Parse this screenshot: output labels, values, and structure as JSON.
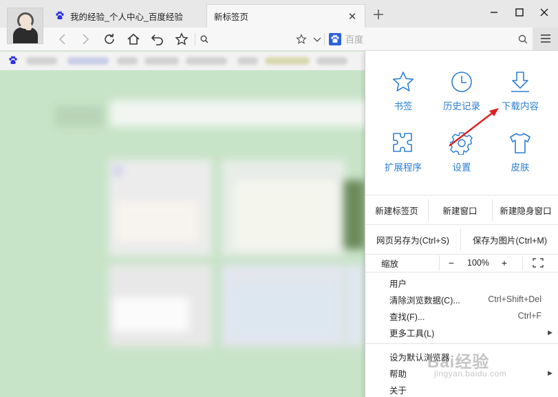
{
  "tabs": [
    {
      "title": "我的经验_个人中心_百度经验",
      "active": false
    },
    {
      "title": "新标签页",
      "active": true
    }
  ],
  "toolbar": {
    "search_placeholder": "百度",
    "address_value": ""
  },
  "menu": {
    "grid": [
      {
        "label": "书签",
        "icon": "star-icon"
      },
      {
        "label": "历史记录",
        "icon": "clock-icon"
      },
      {
        "label": "下载内容",
        "icon": "download-icon"
      },
      {
        "label": "扩展程序",
        "icon": "puzzle-icon"
      },
      {
        "label": "设置",
        "icon": "gear-icon"
      },
      {
        "label": "皮肤",
        "icon": "shirt-icon"
      }
    ],
    "row1": [
      "新建标签页",
      "新建窗口",
      "新建隐身窗口"
    ],
    "row2": [
      "网页另存为(Ctrl+S)",
      "保存为图片(Ctrl+M)"
    ],
    "zoom": {
      "label": "缩放",
      "minus": "−",
      "value": "100%",
      "plus": "+"
    },
    "items": [
      {
        "label": "用户",
        "shortcut": "",
        "submenu": false
      },
      {
        "label": "清除浏览数据(C)...",
        "shortcut": "Ctrl+Shift+Del",
        "submenu": false
      },
      {
        "label": "查找(F)...",
        "shortcut": "Ctrl+F",
        "submenu": false
      },
      {
        "label": "更多工具(L)",
        "shortcut": "",
        "submenu": true
      },
      {
        "label": "设为默认浏览器",
        "shortcut": "",
        "submenu": false
      },
      {
        "label": "帮助",
        "shortcut": "",
        "submenu": true
      },
      {
        "label": "关于",
        "shortcut": "",
        "submenu": false
      }
    ]
  },
  "watermark": {
    "brand": "Bai经验",
    "url": "jingyan.baidu.com"
  },
  "colors": {
    "accent": "#2d7fd4",
    "arrow": "#e0201f",
    "page_bg": "#c8e4c8"
  }
}
